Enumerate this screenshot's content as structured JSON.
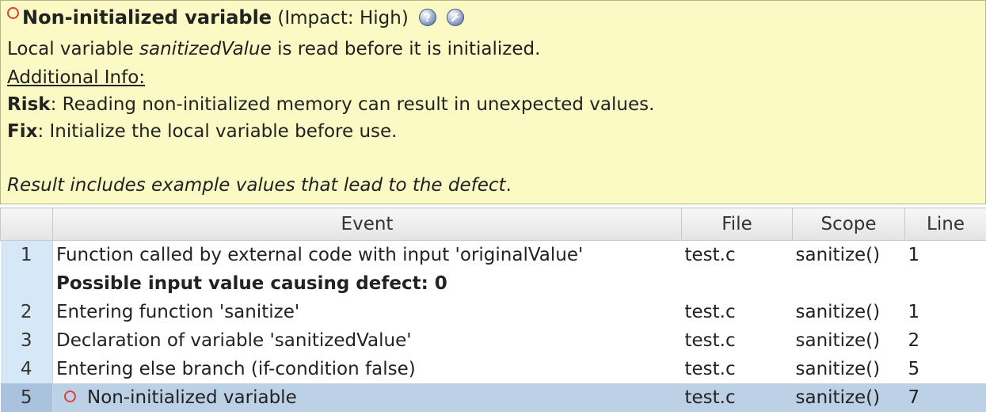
{
  "header": {
    "title": "Non-initialized variable",
    "impact": "(Impact: High)",
    "message_pre": "Local variable ",
    "message_var": "sanitizedValue",
    "message_post": " is read before it is initialized.",
    "additional_info": "Additional Info:",
    "risk_label": "Risk",
    "risk_text": ": Reading non-initialized memory can result in unexpected values.",
    "fix_label": "Fix",
    "fix_text": ": Initialize the local variable before use.",
    "note_italic": "Result includes example values that lead to the defect",
    "note_end": "."
  },
  "table": {
    "columns": [
      "Event",
      "File",
      "Scope",
      "Line"
    ],
    "rows": [
      {
        "num": "1",
        "event": "Function called by external code with input 'originalValue'",
        "detail": "Possible input value causing defect: 0",
        "file": "test.c",
        "scope": "sanitize()",
        "line": "1"
      },
      {
        "num": "2",
        "event": "Entering function 'sanitize'",
        "file": "test.c",
        "scope": "sanitize()",
        "line": "1"
      },
      {
        "num": "3",
        "event": "Declaration of variable 'sanitizedValue'",
        "file": "test.c",
        "scope": "sanitize()",
        "line": "2"
      },
      {
        "num": "4",
        "event": "Entering else branch (if-condition false)",
        "file": "test.c",
        "scope": "sanitize()",
        "line": "5"
      },
      {
        "num": "5",
        "event": "Non-initialized variable",
        "file": "test.c",
        "scope": "sanitize()",
        "line": "7"
      }
    ]
  },
  "icons": {
    "defect": "circle-icon",
    "help": "help-icon",
    "fix": "wrench-icon"
  },
  "colors": {
    "panel_bg": "#fbf9c4",
    "defect_circle": "#e0403c",
    "selected_row": "#bcd0e6"
  }
}
